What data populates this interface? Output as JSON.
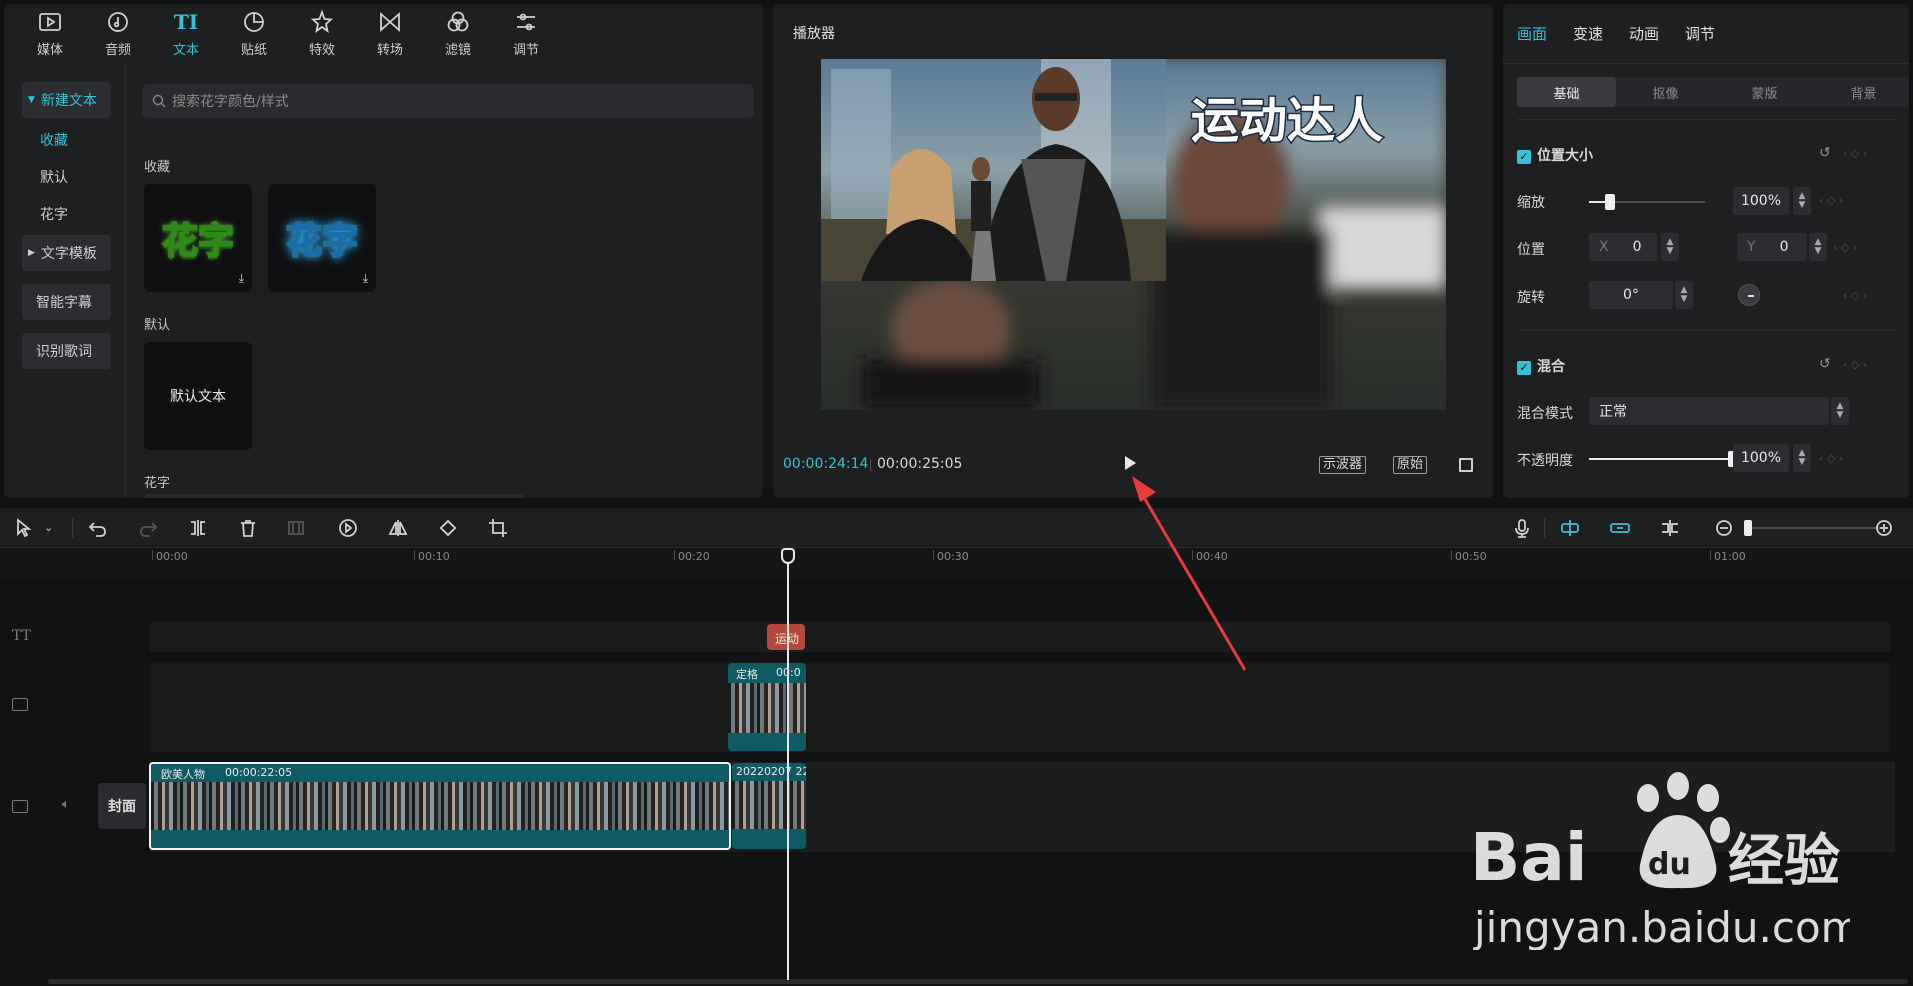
{
  "left_panel": {
    "tabs": [
      {
        "label": "媒体",
        "icon": "media-icon"
      },
      {
        "label": "音频",
        "icon": "audio-icon"
      },
      {
        "label": "文本",
        "icon": "text-icon",
        "glyph": "TI"
      },
      {
        "label": "贴纸",
        "icon": "sticker-icon"
      },
      {
        "label": "特效",
        "icon": "effects-icon"
      },
      {
        "label": "转场",
        "icon": "transition-icon"
      },
      {
        "label": "滤镜",
        "icon": "filter-icon"
      },
      {
        "label": "调节",
        "icon": "adjust-icon"
      }
    ],
    "sidebar": {
      "new_text": "新建文本",
      "favorites": "收藏",
      "default": "默认",
      "fancy": "花字",
      "text_template": "文字模板",
      "smart_caption": "智能字幕",
      "recognize_lyrics": "识别歌词"
    },
    "search_placeholder": "搜索花字颜色/样式",
    "sections": {
      "favorites": "收藏",
      "default": "默认",
      "fancy": "花字"
    },
    "cards": {
      "fancy_text": "花字",
      "default_text": "默认文本"
    }
  },
  "player": {
    "title": "播放器",
    "overlay_text": "运动达人",
    "current_time": "00:00:24:14",
    "total_time": "00:00:25:05",
    "scope_button": "示波器",
    "original_button": "原始"
  },
  "props": {
    "tabs": [
      "画面",
      "变速",
      "动画",
      "调节"
    ],
    "subtabs": [
      "基础",
      "抠像",
      "蒙版",
      "背景"
    ],
    "position_size": {
      "title": "位置大小",
      "scale_label": "缩放",
      "scale_value": "100%",
      "scale_fraction": 0.18,
      "position_label": "位置",
      "x_axis": "X",
      "x_value": "0",
      "y_axis": "Y",
      "y_value": "0",
      "rotate_label": "旋转",
      "rotate_value": "0°"
    },
    "blend": {
      "title": "混合",
      "mode_label": "混合模式",
      "mode_value": "正常",
      "opacity_label": "不透明度",
      "opacity_value": "100%",
      "opacity_fraction": 1.0
    }
  },
  "timeline": {
    "ruler_labels": [
      "00:00",
      "00:10",
      "00:20",
      "00:30",
      "00:40",
      "00:50",
      "01:00"
    ],
    "text_track_glyph": "TT",
    "text_clip_label": "运动",
    "freeze_clip_label": "定格",
    "freeze_clip_time": "00:0",
    "main_clip_name": "欧美人物",
    "main_clip_duration": "00:00:22:05",
    "second_clip_name": "20220207 22",
    "cover_label": "封面"
  },
  "watermark": {
    "brand": "Bai",
    "brand_suffix": "经验",
    "paw_text": "du",
    "url": "jingyan.baidu.com"
  },
  "colors": {
    "accent": "#35c2d6",
    "clip": "#0f5a63",
    "text_clip": "#b4483a",
    "annotation_arrow": "#e83c3c"
  }
}
